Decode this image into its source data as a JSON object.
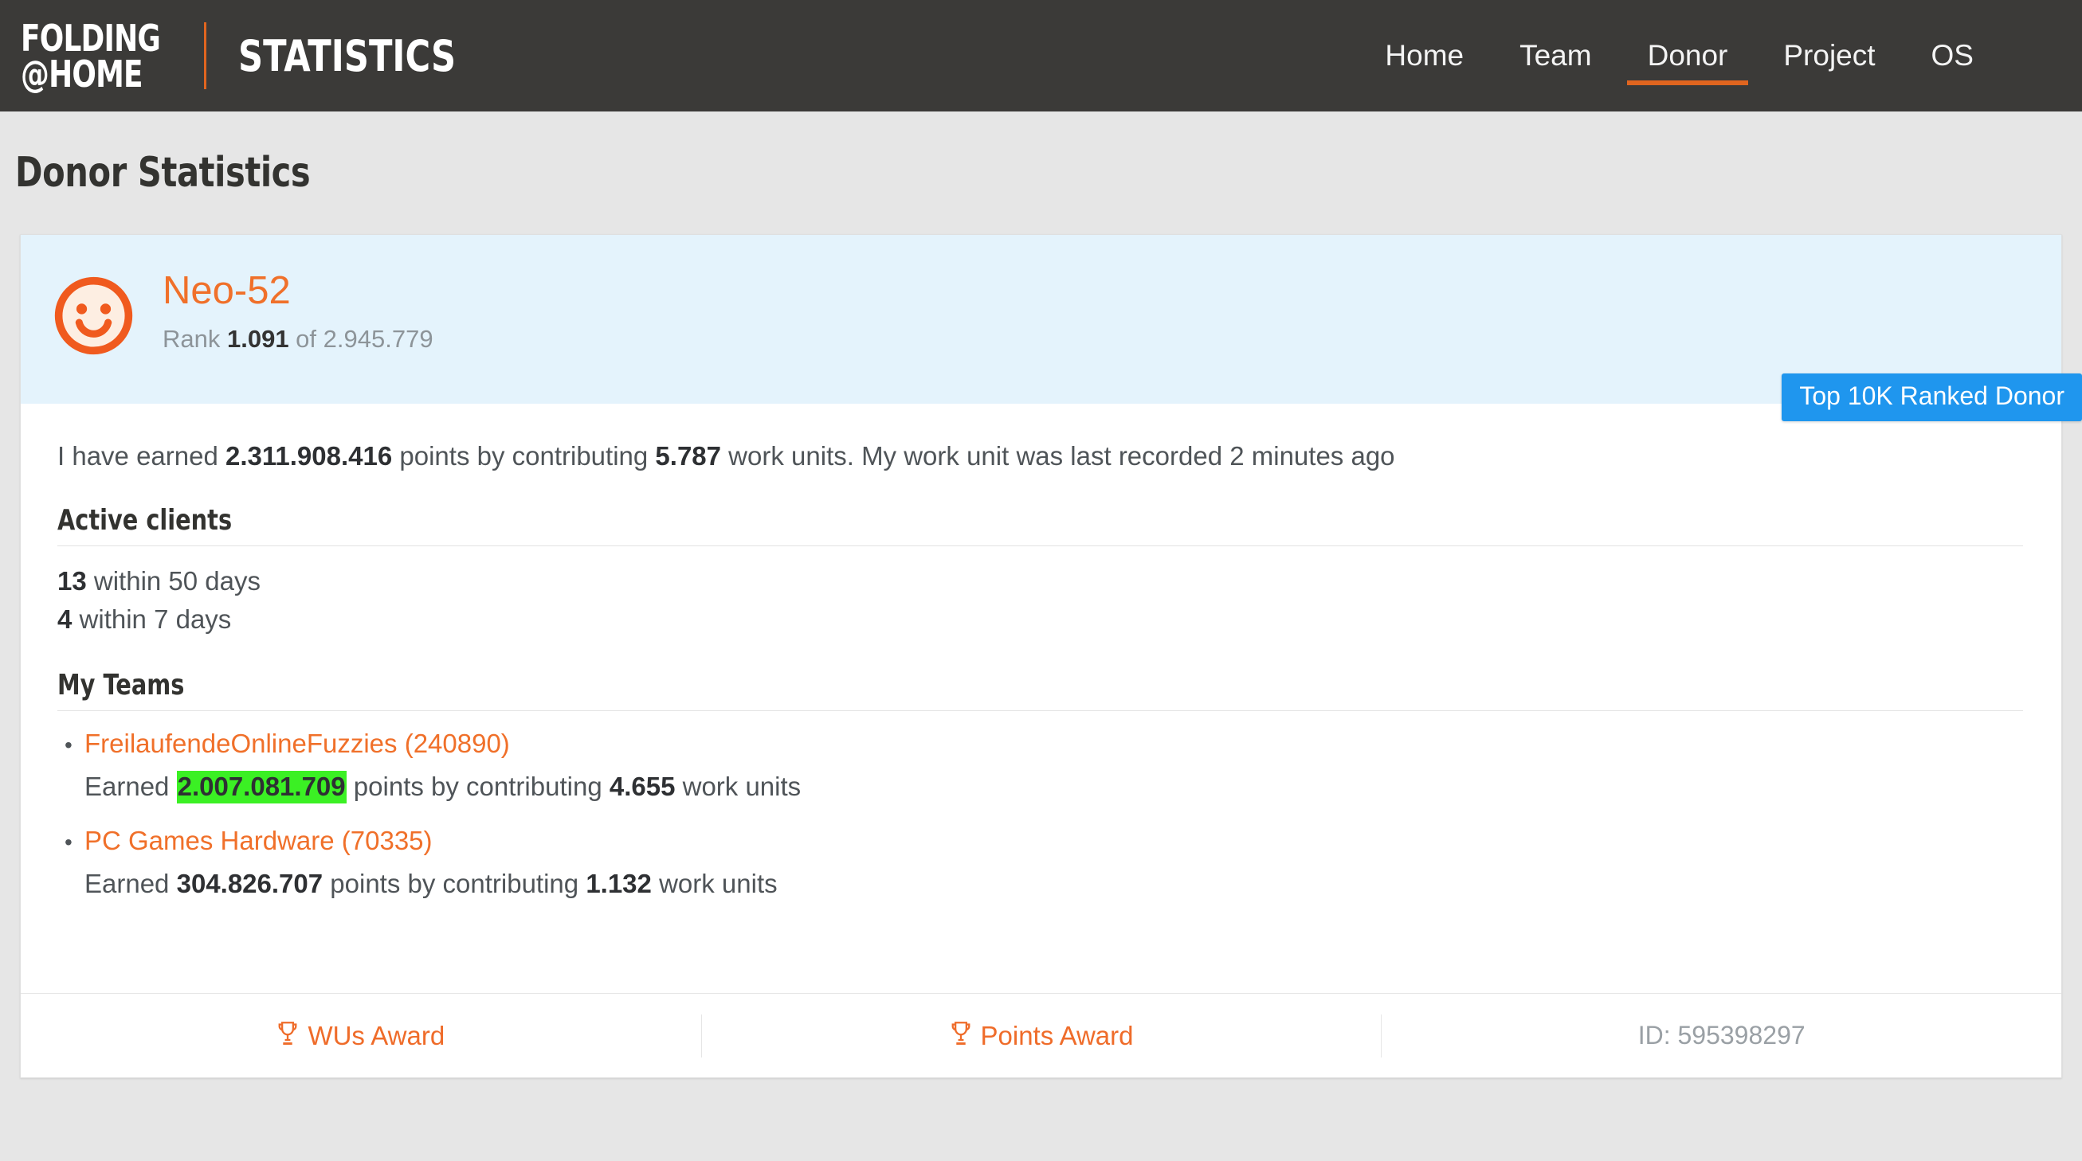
{
  "header": {
    "logo_line1": "FOLDING",
    "logo_line2": "@HOME",
    "title": "STATISTICS",
    "nav": [
      {
        "label": "Home",
        "active": false
      },
      {
        "label": "Team",
        "active": false
      },
      {
        "label": "Donor",
        "active": true
      },
      {
        "label": "Project",
        "active": false
      },
      {
        "label": "OS",
        "active": false
      }
    ]
  },
  "page": {
    "title": "Donor Statistics"
  },
  "donor": {
    "name": "Neo-52",
    "avatar_icon": "smiley-face-icon",
    "rank_prefix": "Rank ",
    "rank_value": "1.091",
    "rank_middle": " of ",
    "rank_total": "2.945.779",
    "badge": "Top 10K Ranked Donor",
    "id_label": "ID: 595398297"
  },
  "summary": {
    "prefix": "I have earned ",
    "points": "2.311.908.416",
    "middle": " points by contributing ",
    "work_units": "5.787",
    "suffix": " work units. My work unit was last recorded 2 minutes ago"
  },
  "active_clients": {
    "heading": "Active clients",
    "rows": [
      {
        "count": "13",
        "text": " within 50 days"
      },
      {
        "count": "4",
        "text": " within 7 days"
      }
    ]
  },
  "teams": {
    "heading": "My Teams",
    "items": [
      {
        "name": "FreilaufendeOnlineFuzzies (240890)",
        "earned_prefix": "Earned ",
        "points": "2.007.081.709",
        "points_highlighted": true,
        "earned_middle": " points by contributing ",
        "work_units": "4.655",
        "earned_suffix": " work units"
      },
      {
        "name": "PC Games Hardware (70335)",
        "earned_prefix": "Earned ",
        "points": "304.826.707",
        "points_highlighted": false,
        "earned_middle": " points by contributing ",
        "work_units": "1.132",
        "earned_suffix": " work units"
      }
    ],
    "bullet": "•"
  },
  "footer": {
    "wus_award": "WUs Award",
    "points_award": "Points Award",
    "trophy_icon": "trophy-icon"
  },
  "colors": {
    "brand_orange": "#e0651f",
    "link_orange": "#f0702a",
    "header_dark": "#3b3a38",
    "card_blue": "#e4f3fc",
    "badge_blue": "#1f96ee",
    "highlight_green": "#3bf024",
    "page_bg": "#e6e6e6"
  }
}
